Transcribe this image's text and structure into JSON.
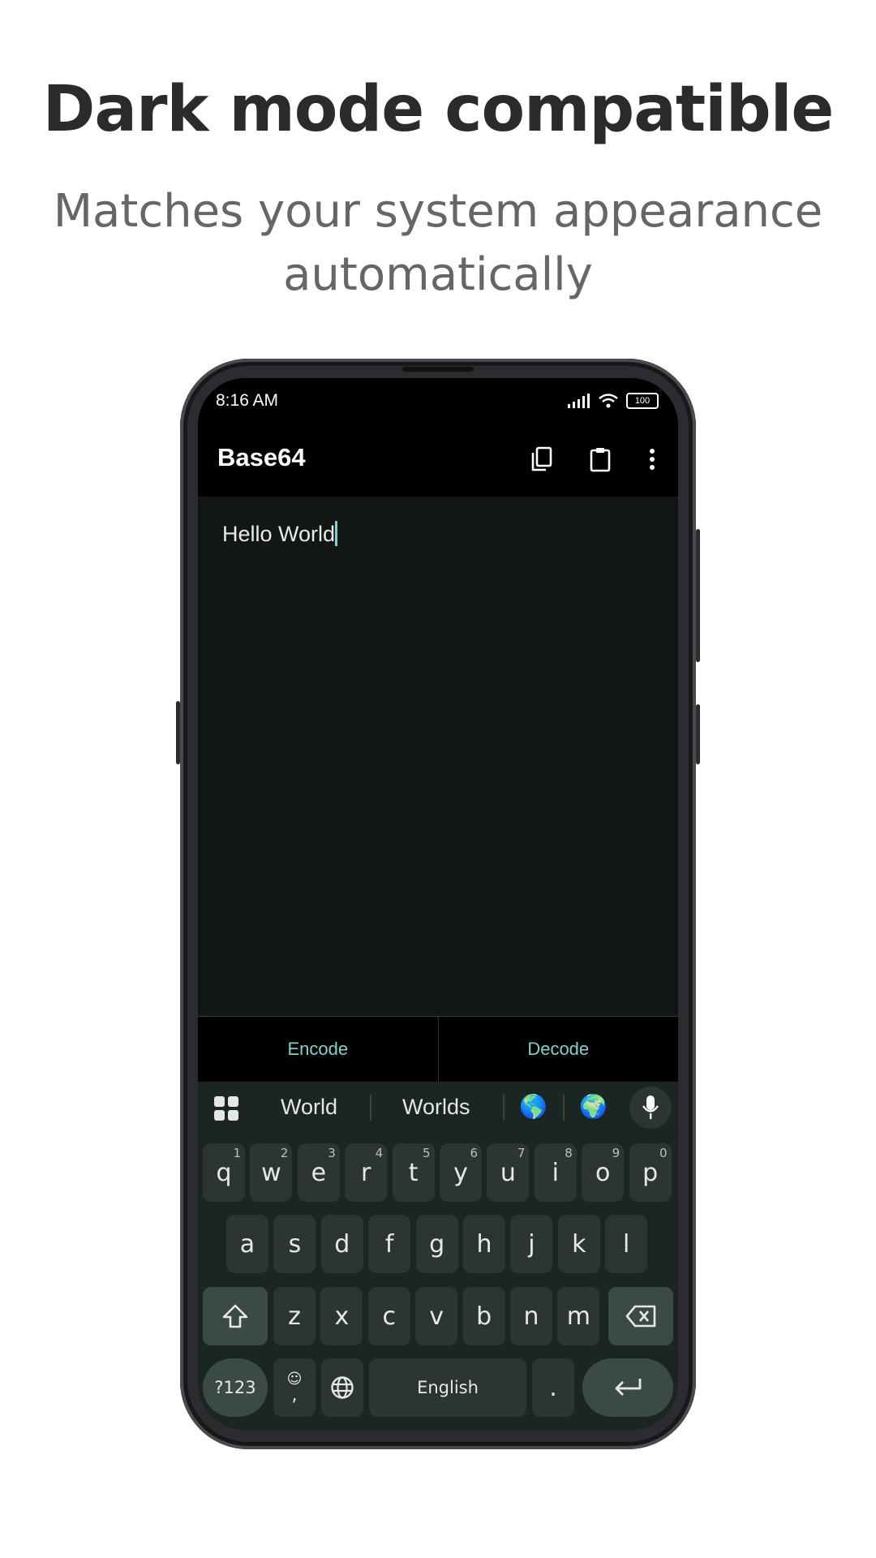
{
  "headline": "Dark mode compatible",
  "subline": "Matches your system appearance automatically",
  "status": {
    "time": "8:16 AM",
    "battery": "100"
  },
  "appbar": {
    "title": "Base64",
    "actions": [
      "copy-icon",
      "clipboard-icon",
      "more-vert-icon"
    ]
  },
  "editor": {
    "value": "Hello World"
  },
  "tabs": {
    "encode": "Encode",
    "decode": "Decode"
  },
  "keyboard": {
    "suggestions": [
      "World",
      "Worlds"
    ],
    "emoji": [
      "🌎",
      "🌍"
    ],
    "row1": [
      {
        "k": "q",
        "h": "1"
      },
      {
        "k": "w",
        "h": "2"
      },
      {
        "k": "e",
        "h": "3"
      },
      {
        "k": "r",
        "h": "4"
      },
      {
        "k": "t",
        "h": "5"
      },
      {
        "k": "y",
        "h": "6"
      },
      {
        "k": "u",
        "h": "7"
      },
      {
        "k": "i",
        "h": "8"
      },
      {
        "k": "o",
        "h": "9"
      },
      {
        "k": "p",
        "h": "0"
      }
    ],
    "row2": [
      "a",
      "s",
      "d",
      "f",
      "g",
      "h",
      "j",
      "k",
      "l"
    ],
    "row3": [
      "z",
      "x",
      "c",
      "v",
      "b",
      "n",
      "m"
    ],
    "symbols": "?123",
    "comma": ",",
    "space": "English",
    "period": "."
  },
  "colors": {
    "accent": "#7fd3c8",
    "editor_bg": "#121614",
    "keyboard_bg": "#1b2522",
    "key_bg": "#2c3532"
  }
}
